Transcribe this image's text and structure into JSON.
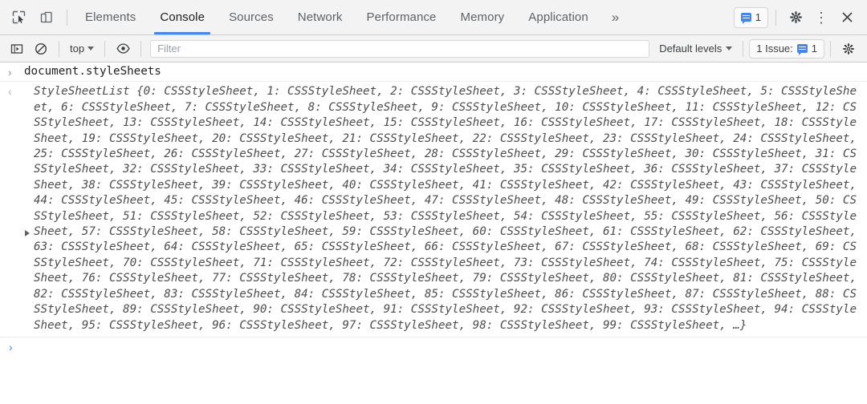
{
  "tabbar": {
    "left_icons": [
      {
        "name": "inspect-element-icon",
        "title": "Inspect element"
      },
      {
        "name": "device-toolbar-icon",
        "title": "Toggle device toolbar"
      }
    ],
    "tabs": [
      {
        "label": "Elements",
        "selected": false
      },
      {
        "label": "Console",
        "selected": true
      },
      {
        "label": "Sources",
        "selected": false
      },
      {
        "label": "Network",
        "selected": false
      },
      {
        "label": "Performance",
        "selected": false
      },
      {
        "label": "Memory",
        "selected": false
      },
      {
        "label": "Application",
        "selected": false
      }
    ],
    "more_tabs_label": "»",
    "issues_count": "1",
    "settings_label": "⚙",
    "kebab_label": "⋮",
    "close_label": "✕"
  },
  "toolbar": {
    "context_label": "top",
    "filter_placeholder": "Filter",
    "filter_value": "",
    "levels_label": "Default levels",
    "issue_label": "1 Issue:",
    "issue_count": "1",
    "console_settings_label": "⚙",
    "icons": {
      "sidebar": "console-sidebar-icon",
      "clear": "clear-console-icon",
      "eye": "live-expression-eye-icon"
    }
  },
  "console": {
    "command_marker": "›",
    "command_text": "document.styleSheets",
    "result_marker": "‹",
    "result_text": "StyleSheetList {0: CSSStyleSheet, 1: CSSStyleSheet, 2: CSSStyleSheet, 3: CSSStyleSheet, 4: CSSStyleSheet, 5: CSSStyleSheet, 6: CSSStyleSheet, 7: CSSStyleSheet, 8: CSSStyleSheet, 9: CSSStyleSheet, 10: CSSStyleSheet, 11: CSSStyleSheet, 12: CSSStyleSheet, 13: CSSStyleSheet, 14: CSSStyleSheet, 15: CSSStyleSheet, 16: CSSStyleSheet, 17: CSSStyleSheet, 18: CSSStyleSheet, 19: CSSStyleSheet, 20: CSSStyleSheet, 21: CSSStyleSheet, 22: CSSStyleSheet, 23: CSSStyleSheet, 24: CSSStyleSheet, 25: CSSStyleSheet, 26: CSSStyleSheet, 27: CSSStyleSheet, 28: CSSStyleSheet, 29: CSSStyleSheet, 30: CSSStyleSheet, 31: CSSStyleSheet, 32: CSSStyleSheet, 33: CSSStyleSheet, 34: CSSStyleSheet, 35: CSSStyleSheet, 36: CSSStyleSheet, 37: CSSStyleSheet, 38: CSSStyleSheet, 39: CSSStyleSheet, 40: CSSStyleSheet, 41: CSSStyleSheet, 42: CSSStyleSheet, 43: CSSStyleSheet, 44: CSSStyleSheet, 45: CSSStyleSheet, 46: CSSStyleSheet, 47: CSSStyleSheet, 48: CSSStyleSheet, 49: CSSStyleSheet, 50: CSSStyleSheet, 51: CSSStyleSheet, 52: CSSStyleSheet, 53: CSSStyleSheet, 54: CSSStyleSheet, 55: CSSStyleSheet, 56: CSSStyleSheet, 57: CSSStyleSheet, 58: CSSStyleSheet, 59: CSSStyleSheet, 60: CSSStyleSheet, 61: CSSStyleSheet, 62: CSSStyleSheet, 63: CSSStyleSheet, 64: CSSStyleSheet, 65: CSSStyleSheet, 66: CSSStyleSheet, 67: CSSStyleSheet, 68: CSSStyleSheet, 69: CSSStyleSheet, 70: CSSStyleSheet, 71: CSSStyleSheet, 72: CSSStyleSheet, 73: CSSStyleSheet, 74: CSSStyleSheet, 75: CSSStyleSheet, 76: CSSStyleSheet, 77: CSSStyleSheet, 78: CSSStyleSheet, 79: CSSStyleSheet, 80: CSSStyleSheet, 81: CSSStyleSheet, 82: CSSStyleSheet, 83: CSSStyleSheet, 84: CSSStyleSheet, 85: CSSStyleSheet, 86: CSSStyleSheet, 87: CSSStyleSheet, 88: CSSStyleSheet, 89: CSSStyleSheet, 90: CSSStyleSheet, 91: CSSStyleSheet, 92: CSSStyleSheet, 93: CSSStyleSheet, 94: CSSStyleSheet, 95: CSSStyleSheet, 96: CSSStyleSheet, 97: CSSStyleSheet, 98: CSSStyleSheet, 99: CSSStyleSheet, …}",
    "prompt_marker": "›",
    "prompt_value": ""
  },
  "colors": {
    "accent": "#4285f4",
    "toolbar_bg": "#f3f3f3",
    "text": "#202124",
    "muted": "#5f6368",
    "result_text": "#4d4d4d"
  }
}
